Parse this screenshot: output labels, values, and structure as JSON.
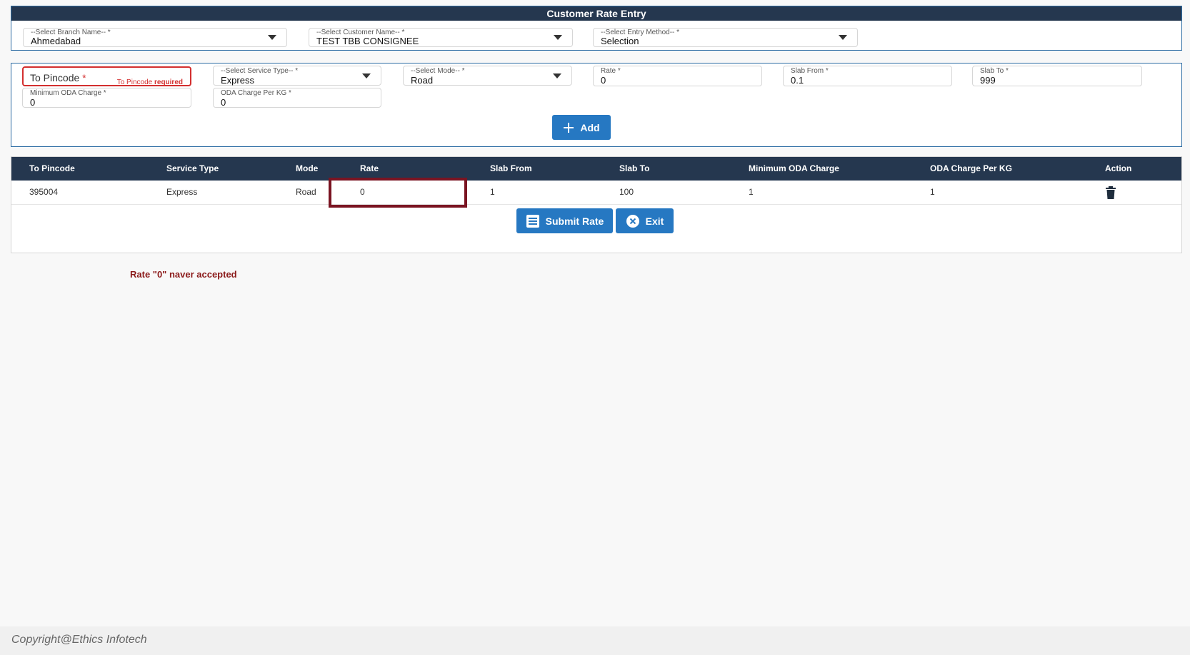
{
  "page": {
    "title": "Customer Rate Entry"
  },
  "top_selects": {
    "branch": {
      "label": "--Select Branch Name-- *",
      "value": "Ahmedabad"
    },
    "customer": {
      "label": "--Select Customer Name-- *",
      "value": "TEST TBB CONSIGNEE"
    },
    "entry_method": {
      "label": "--Select Entry Method-- *",
      "value": "Selection"
    }
  },
  "form": {
    "to_pincode": {
      "placeholder": "To Pincode",
      "required_mark": "*",
      "error_prefix": "To Pincode",
      "error_suffix": "required"
    },
    "service_type": {
      "label": "--Select Service Type-- *",
      "value": "Express"
    },
    "mode": {
      "label": "--Select Mode-- *",
      "value": "Road"
    },
    "rate": {
      "label": "Rate *",
      "value": "0"
    },
    "slab_from": {
      "label": "Slab From *",
      "value": "0.1"
    },
    "slab_to": {
      "label": "Slab To *",
      "value": "999"
    },
    "min_oda": {
      "label": "Minimum ODA Charge *",
      "value": "0"
    },
    "oda_per_kg": {
      "label": "ODA Charge Per KG *",
      "value": "0"
    },
    "add_label": "Add"
  },
  "table": {
    "headers": [
      "To Pincode",
      "Service Type",
      "Mode",
      "Rate",
      "Slab From",
      "Slab To",
      "Minimum ODA Charge",
      "ODA Charge Per KG",
      "Action"
    ],
    "rows": [
      [
        "395004",
        "Express",
        "Road",
        "0",
        "1",
        "100",
        "1",
        "1"
      ]
    ]
  },
  "actions": {
    "submit_label": "Submit Rate",
    "exit_label": "Exit"
  },
  "annotation": {
    "note": "Rate \"0\" naver accepted",
    "color": "#7a1422"
  },
  "footer": {
    "copyright": "Copyright@Ethics Infotech"
  },
  "colors": {
    "header_bg": "#25374f",
    "button_bg": "#2678c2",
    "error": "#d32f2f"
  }
}
